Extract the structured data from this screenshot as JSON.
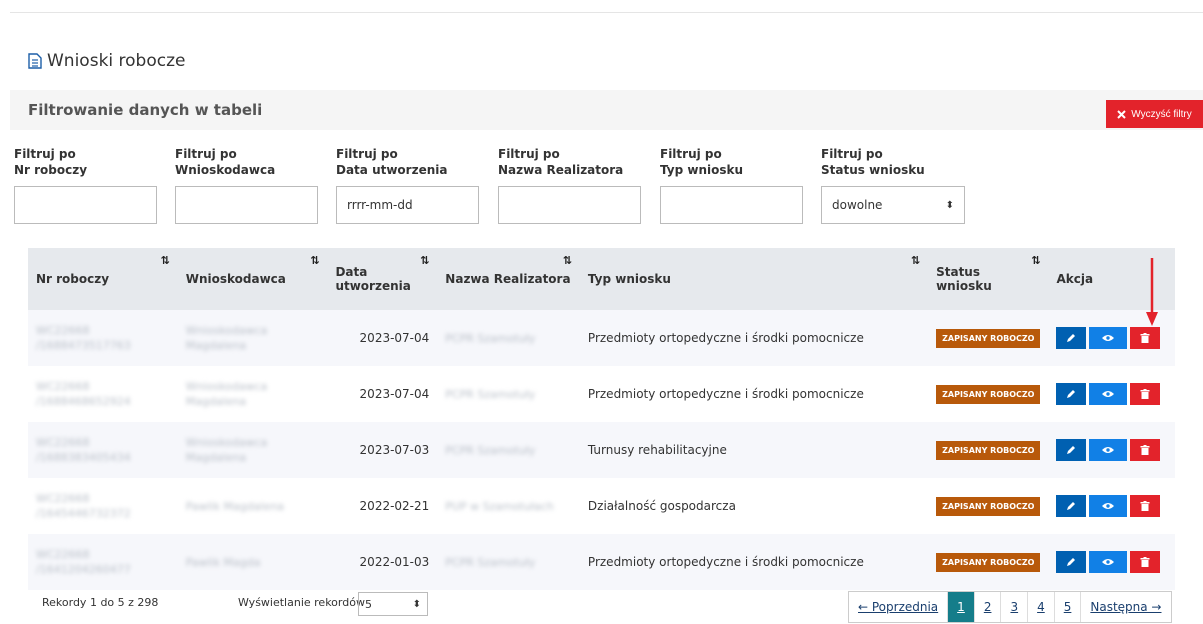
{
  "page": {
    "title": "Wnioski robocze"
  },
  "filters": {
    "heading": "Filtrowanie danych w tabeli",
    "clear_label": "Wyczyść filtry",
    "fields": [
      {
        "label1": "Filtruj po",
        "label2": "Nr roboczy",
        "value": ""
      },
      {
        "label1": "Filtruj po",
        "label2": "Wnioskodawca",
        "value": ""
      },
      {
        "label1": "Filtruj po",
        "label2": "Data utworzenia",
        "value": "rrrr-mm-dd"
      },
      {
        "label1": "Filtruj po",
        "label2": "Nazwa Realizatora",
        "value": ""
      },
      {
        "label1": "Filtruj po",
        "label2": "Typ wniosku",
        "value": ""
      },
      {
        "label1": "Filtruj po",
        "label2": "Status wniosku",
        "value": "dowolne"
      }
    ]
  },
  "table": {
    "headers": {
      "nr": "Nr roboczy",
      "wnioskodawca": "Wnioskodawca",
      "data1": "Data",
      "data2": "utworzenia",
      "realizator": "Nazwa Realizatora",
      "typ": "Typ wniosku",
      "status1": "Status",
      "status2": "wniosku",
      "akcja": "Akcja"
    },
    "rows": [
      {
        "nr1": "WC22668",
        "nr2": "/1688473517763",
        "w1": "Wnioskodawca",
        "w2": "Magdalena",
        "date": "2023-07-04",
        "realizator": "PCPR Szamotuły",
        "typ": "Przedmioty ortopedyczne i środki pomocnicze",
        "status": "ZAPISANY ROBOCZO"
      },
      {
        "nr1": "WC22668",
        "nr2": "/1688468652924",
        "w1": "Wnioskodawca",
        "w2": "Magdalena",
        "date": "2023-07-04",
        "realizator": "PCPR Szamotuły",
        "typ": "Przedmioty ortopedyczne i środki pomocnicze",
        "status": "ZAPISANY ROBOCZO"
      },
      {
        "nr1": "WC22668",
        "nr2": "/1688383405434",
        "w1": "Wnioskodawca",
        "w2": "Magdalena",
        "date": "2023-07-03",
        "realizator": "PCPR Szamotuły",
        "typ": "Turnusy rehabilitacyjne",
        "status": "ZAPISANY ROBOCZO"
      },
      {
        "nr1": "WC22668",
        "nr2": "/1645446732372",
        "w1": "Pawlik Magdalena",
        "w2": "",
        "date": "2022-02-21",
        "realizator": "PUP w Szamotułach",
        "typ": "Działalność gospodarcza",
        "status": "ZAPISANY ROBOCZO"
      },
      {
        "nr1": "WC22668",
        "nr2": "/1641204260477",
        "w1": "Pawlik Magda",
        "w2": "",
        "date": "2022-01-03",
        "realizator": "PCPR Szamotuły",
        "typ": "Przedmioty ortopedyczne i środki pomocnicze",
        "status": "ZAPISANY ROBOCZO"
      }
    ]
  },
  "footer": {
    "records": "Rekordy 1 do 5 z 298",
    "per_page_label": "Wyświetlanie rekordów",
    "per_page_value": "5"
  },
  "pagination": {
    "prev": "← Poprzednia",
    "pages": [
      "1",
      "2",
      "3",
      "4",
      "5"
    ],
    "next": "Następna →"
  },
  "colors": {
    "delete": "#e3232b",
    "edit": "#0060b1",
    "view": "#1180e6",
    "status_badge": "#b8590a",
    "active_page": "#157d8a"
  }
}
